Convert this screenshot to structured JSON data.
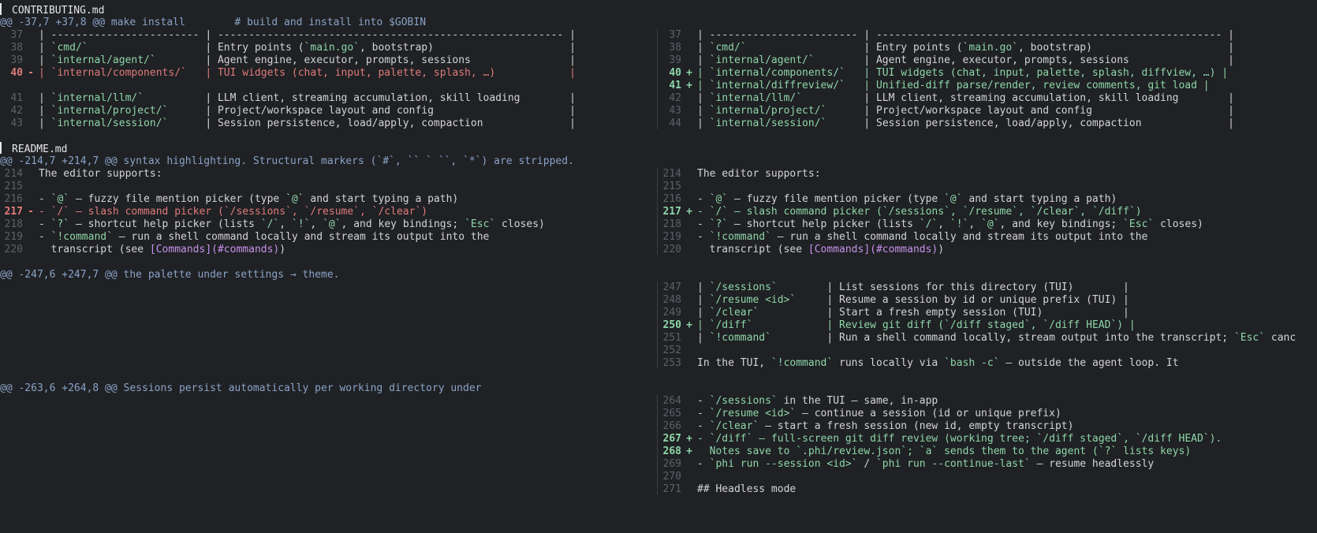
{
  "files": [
    {
      "name": "CONTRIBUTING.md",
      "hunks": [
        {
          "header": "@@ -37,7 +37,8 @@ make install        # build and install into $GOBIN",
          "left": [
            {
              "n": "37",
              "m": "",
              "t": "| ------------------------ | -------------------------------------------------------- |"
            },
            {
              "n": "38",
              "m": "",
              "t": "| `cmd/`                   | Entry points (`main.go`, bootstrap)                      |"
            },
            {
              "n": "39",
              "m": "",
              "t": "| `internal/agent/`        | Agent engine, executor, prompts, sessions                |"
            },
            {
              "n": "40",
              "m": "-",
              "t": "| `internal/components/`   | TUI widgets (chat, input, palette, splash, …)            |"
            },
            {
              "n": "",
              "m": "",
              "t": ""
            },
            {
              "n": "41",
              "m": "",
              "t": "| `internal/llm/`          | LLM client, streaming accumulation, skill loading        |"
            },
            {
              "n": "42",
              "m": "",
              "t": "| `internal/project/`      | Project/workspace layout and config                      |"
            },
            {
              "n": "43",
              "m": "",
              "t": "| `internal/session/`      | Session persistence, load/apply, compaction              |"
            }
          ],
          "right": [
            {
              "n": "37",
              "m": "",
              "t": "| ------------------------ | -------------------------------------------------------- |"
            },
            {
              "n": "38",
              "m": "",
              "t": "| `cmd/`                   | Entry points (`main.go`, bootstrap)                      |"
            },
            {
              "n": "39",
              "m": "",
              "t": "| `internal/agent/`        | Agent engine, executor, prompts, sessions                |"
            },
            {
              "n": "40",
              "m": "+",
              "t": "| `internal/components/`   | TUI widgets (chat, input, palette, splash, diffview, …) |"
            },
            {
              "n": "41",
              "m": "+",
              "t": "| `internal/diffreview/`   | Unified-diff parse/render, review comments, git load |"
            },
            {
              "n": "42",
              "m": "",
              "t": "| `internal/llm/`          | LLM client, streaming accumulation, skill loading        |"
            },
            {
              "n": "43",
              "m": "",
              "t": "| `internal/project/`      | Project/workspace layout and config                      |"
            },
            {
              "n": "44",
              "m": "",
              "t": "| `internal/session/`      | Session persistence, load/apply, compaction              |"
            }
          ]
        }
      ]
    },
    {
      "name": "README.md",
      "hunks": [
        {
          "header": "@@ -214,7 +214,7 @@ syntax highlighting. Structural markers (`#`, `` ` ``, `*`) are stripped.",
          "left": [
            {
              "n": "214",
              "m": "",
              "t": "The editor supports:"
            },
            {
              "n": "215",
              "m": "",
              "t": ""
            },
            {
              "n": "216",
              "m": "",
              "t": "- `@` — fuzzy file mention picker (type `@` and start typing a path)"
            },
            {
              "n": "217",
              "m": "-",
              "t": "- `/` — slash command picker (`/sessions`, `/resume`, `/clear`)"
            },
            {
              "n": "218",
              "m": "",
              "t": "- `?` — shortcut help picker (lists `/`, `!`, `@`, and key bindings; `Esc` closes)"
            },
            {
              "n": "219",
              "m": "",
              "t": "- `!command` — run a shell command locally and stream its output into the"
            },
            {
              "n": "220",
              "m": "",
              "t": "  transcript (see [Commands](#commands))"
            }
          ],
          "right": [
            {
              "n": "214",
              "m": "",
              "t": "The editor supports:"
            },
            {
              "n": "215",
              "m": "",
              "t": ""
            },
            {
              "n": "216",
              "m": "",
              "t": "- `@` — fuzzy file mention picker (type `@` and start typing a path)"
            },
            {
              "n": "217",
              "m": "+",
              "t": "- `/` — slash command picker (`/sessions`, `/resume`, `/clear`, `/diff`)"
            },
            {
              "n": "218",
              "m": "",
              "t": "- `?` — shortcut help picker (lists `/`, `!`, `@`, and key bindings; `Esc` closes)"
            },
            {
              "n": "219",
              "m": "",
              "t": "- `!command` — run a shell command locally and stream its output into the"
            },
            {
              "n": "220",
              "m": "",
              "t": "  transcript (see [Commands](#commands))"
            }
          ]
        },
        {
          "header": "@@ -247,6 +247,7 @@ the palette under settings → theme.",
          "left": [],
          "right": [
            {
              "n": "247",
              "m": "",
              "t": "| `/sessions`        | List sessions for this directory (TUI)        |"
            },
            {
              "n": "248",
              "m": "",
              "t": "| `/resume <id>`     | Resume a session by id or unique prefix (TUI) |"
            },
            {
              "n": "249",
              "m": "",
              "t": "| `/clear`           | Start a fresh empty session (TUI)             |"
            },
            {
              "n": "250",
              "m": "+",
              "t": "| `/diff`            | Review git diff (`/diff staged`, `/diff HEAD`) |"
            },
            {
              "n": "251",
              "m": "",
              "t": "| `!command`         | Run a shell command locally, stream output into the transcript; `Esc` canc"
            },
            {
              "n": "252",
              "m": "",
              "t": ""
            },
            {
              "n": "253",
              "m": "",
              "t": "In the TUI, `!command` runs locally via `bash -c` — outside the agent loop. It"
            }
          ]
        },
        {
          "header": "@@ -263,6 +264,8 @@ Sessions persist automatically per working directory under",
          "left": [],
          "right": [
            {
              "n": "264",
              "m": "",
              "t": "- `/sessions` in the TUI — same, in-app"
            },
            {
              "n": "265",
              "m": "",
              "t": "- `/resume <id>` — continue a session (id or unique prefix)"
            },
            {
              "n": "266",
              "m": "",
              "t": "- `/clear` — start a fresh session (new id, empty transcript)"
            },
            {
              "n": "267",
              "m": "+",
              "t": "- `/diff` — full-screen git diff review (working tree; `/diff staged`, `/diff HEAD`)."
            },
            {
              "n": "268",
              "m": "+",
              "t": "  Notes save to `.phi/review.json`; `a` sends them to the agent (`?` lists keys)"
            },
            {
              "n": "269",
              "m": "",
              "t": "- `phi run --session <id>` / `phi run --continue-last` — resume headlessly"
            },
            {
              "n": "270",
              "m": "",
              "t": ""
            },
            {
              "n": "271",
              "m": "",
              "t": "## Headless mode"
            }
          ]
        }
      ]
    }
  ]
}
